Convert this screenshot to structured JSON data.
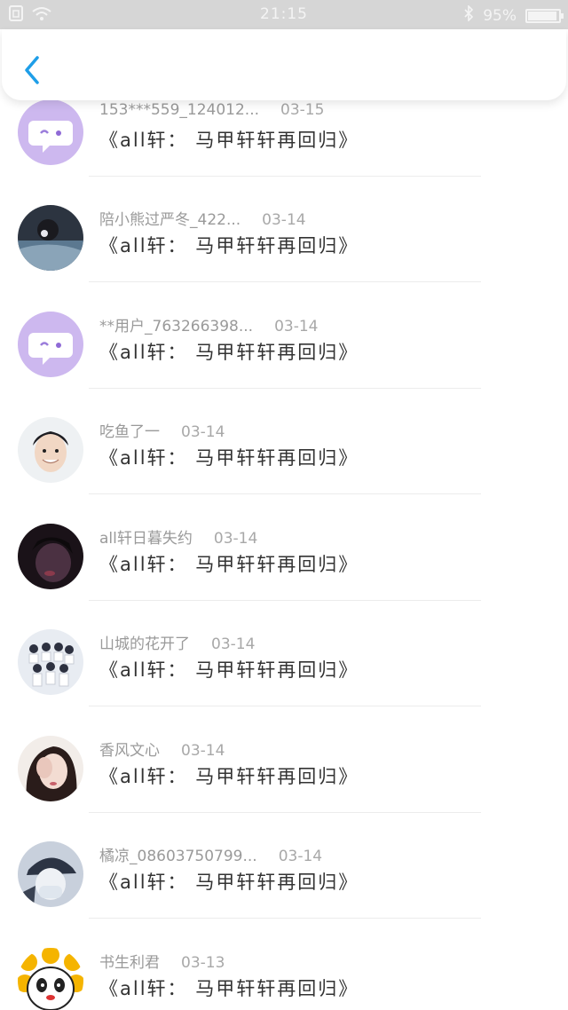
{
  "status_bar": {
    "time": "21:15",
    "battery": "95%",
    "battery_level": 0.95
  },
  "header": {
    "back_icon": "chevron-left-icon",
    "accent_color": "#1e9ee8"
  },
  "comments": [
    {
      "user": "153***559_124012...",
      "date": "03-15",
      "text": "《all轩： 马甲轩轩再回归》",
      "avatar": "default"
    },
    {
      "user": "陪小熊过严冬_422...",
      "date": "03-14",
      "text": "《all轩： 马甲轩轩再回归》",
      "avatar": "photo-headphones"
    },
    {
      "user": "**用户_763266398...",
      "date": "03-14",
      "text": "《all轩： 马甲轩轩再回归》",
      "avatar": "default"
    },
    {
      "user": "吃鱼了一",
      "date": "03-14",
      "text": "《all轩： 马甲轩轩再回归》",
      "avatar": "photo-smile"
    },
    {
      "user": "all轩日暮失约",
      "date": "03-14",
      "text": "《all轩： 马甲轩轩再回归》",
      "avatar": "photo-dark"
    },
    {
      "user": "山城的花开了",
      "date": "03-14",
      "text": "《all轩： 马甲轩轩再回归》",
      "avatar": "photo-group"
    },
    {
      "user": "香风文心",
      "date": "03-14",
      "text": "《all轩： 马甲轩轩再回归》",
      "avatar": "photo-girl"
    },
    {
      "user": "橘凉_08603750799...",
      "date": "03-14",
      "text": "《all轩： 马甲轩轩再回归》",
      "avatar": "photo-cap"
    },
    {
      "user": "书生利君",
      "date": "03-13",
      "text": "《all轩： 马甲轩轩再回归》",
      "avatar": "cartoon-panda"
    }
  ]
}
